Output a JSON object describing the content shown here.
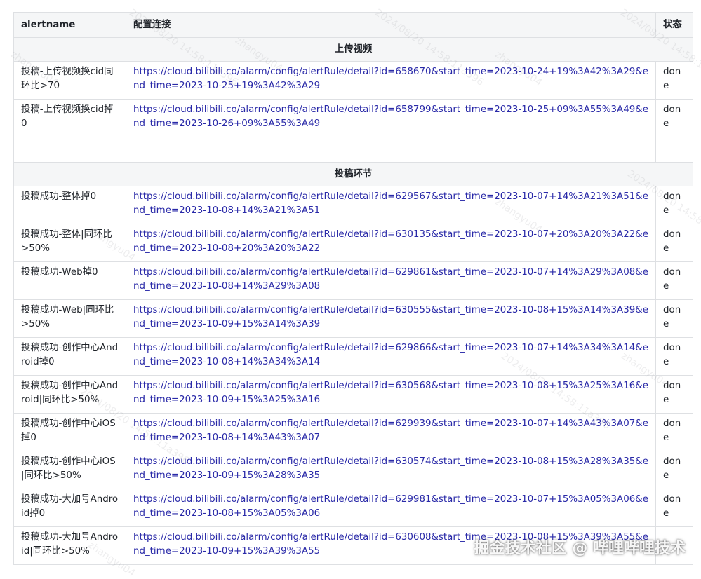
{
  "table": {
    "headers": [
      "alertname",
      "配置连接",
      "状态"
    ],
    "sections": [
      {
        "title": "上传视频",
        "rows": [
          {
            "name": "投稿-上传视频换cid同环比>70",
            "url": "https://cloud.bilibili.co/alarm/config/alertRule/detail?id=658670&start_time=2023-10-24+19%3A42%3A29&end_time=2023-10-25+19%3A42%3A29",
            "status": "done"
          },
          {
            "name": "投稿-上传视频换cid掉0",
            "url": "https://cloud.bilibili.co/alarm/config/alertRule/detail?id=658799&start_time=2023-10-25+09%3A55%3A49&end_time=2023-10-26+09%3A55%3A49",
            "status": "done"
          },
          {
            "name": "",
            "url": "",
            "status": ""
          }
        ]
      },
      {
        "title": "投稿环节",
        "rows": [
          {
            "name": "投稿成功-整体掉0",
            "url": "https://cloud.bilibili.co/alarm/config/alertRule/detail?id=629567&start_time=2023-10-07+14%3A21%3A51&end_time=2023-10-08+14%3A21%3A51",
            "status": "done"
          },
          {
            "name": "投稿成功-整体|同环比>50%",
            "url": "https://cloud.bilibili.co/alarm/config/alertRule/detail?id=630135&start_time=2023-10-07+20%3A20%3A22&end_time=2023-10-08+20%3A20%3A22",
            "status": "done"
          },
          {
            "name": "投稿成功-Web掉0",
            "url": "https://cloud.bilibili.co/alarm/config/alertRule/detail?id=629861&start_time=2023-10-07+14%3A29%3A08&end_time=2023-10-08+14%3A29%3A08",
            "status": "done"
          },
          {
            "name": "投稿成功-Web|同环比>50%",
            "url": "https://cloud.bilibili.co/alarm/config/alertRule/detail?id=630555&start_time=2023-10-08+15%3A14%3A39&end_time=2023-10-09+15%3A14%3A39",
            "status": "done"
          },
          {
            "name": "投稿成功-创作中心Android掉0",
            "url": "https://cloud.bilibili.co/alarm/config/alertRule/detail?id=629866&start_time=2023-10-07+14%3A34%3A14&end_time=2023-10-08+14%3A34%3A14",
            "status": "done"
          },
          {
            "name": "投稿成功-创作中心Android|同环比>50%",
            "url": "https://cloud.bilibili.co/alarm/config/alertRule/detail?id=630568&start_time=2023-10-08+15%3A25%3A16&end_time=2023-10-09+15%3A25%3A16",
            "status": "done"
          },
          {
            "name": "投稿成功-创作中心iOS掉0",
            "url": "https://cloud.bilibili.co/alarm/config/alertRule/detail?id=629939&start_time=2023-10-07+14%3A43%3A07&end_time=2023-10-08+14%3A43%3A07",
            "status": "done"
          },
          {
            "name": "投稿成功-创作中心iOS|同环比>50%",
            "url": "https://cloud.bilibili.co/alarm/config/alertRule/detail?id=630574&start_time=2023-10-08+15%3A28%3A35&end_time=2023-10-09+15%3A28%3A35",
            "status": "done"
          },
          {
            "name": "投稿成功-大加号Android掉0",
            "url": "https://cloud.bilibili.co/alarm/config/alertRule/detail?id=629981&start_time=2023-10-07+15%3A05%3A06&end_time=2023-10-08+15%3A05%3A06",
            "status": "done"
          },
          {
            "name": "投稿成功-大加号Android|同环比>50%",
            "url": "https://cloud.bilibili.co/alarm/config/alertRule/detail?id=630608&start_time=2023-10-08+15%3A39%3A55&end_time=2023-10-09+15%3A39%3A55",
            "status": ""
          }
        ]
      }
    ]
  },
  "watermark": {
    "user": "zhangyu04",
    "datetime": "2024/08/20 14:58:11a396"
  },
  "corner_watermark": "掘金技术社区 @ 哔哩哔哩技术",
  "colors": {
    "link": "#2929a8",
    "header_bg": "#f5f6f7",
    "border": "#dee0e3"
  }
}
